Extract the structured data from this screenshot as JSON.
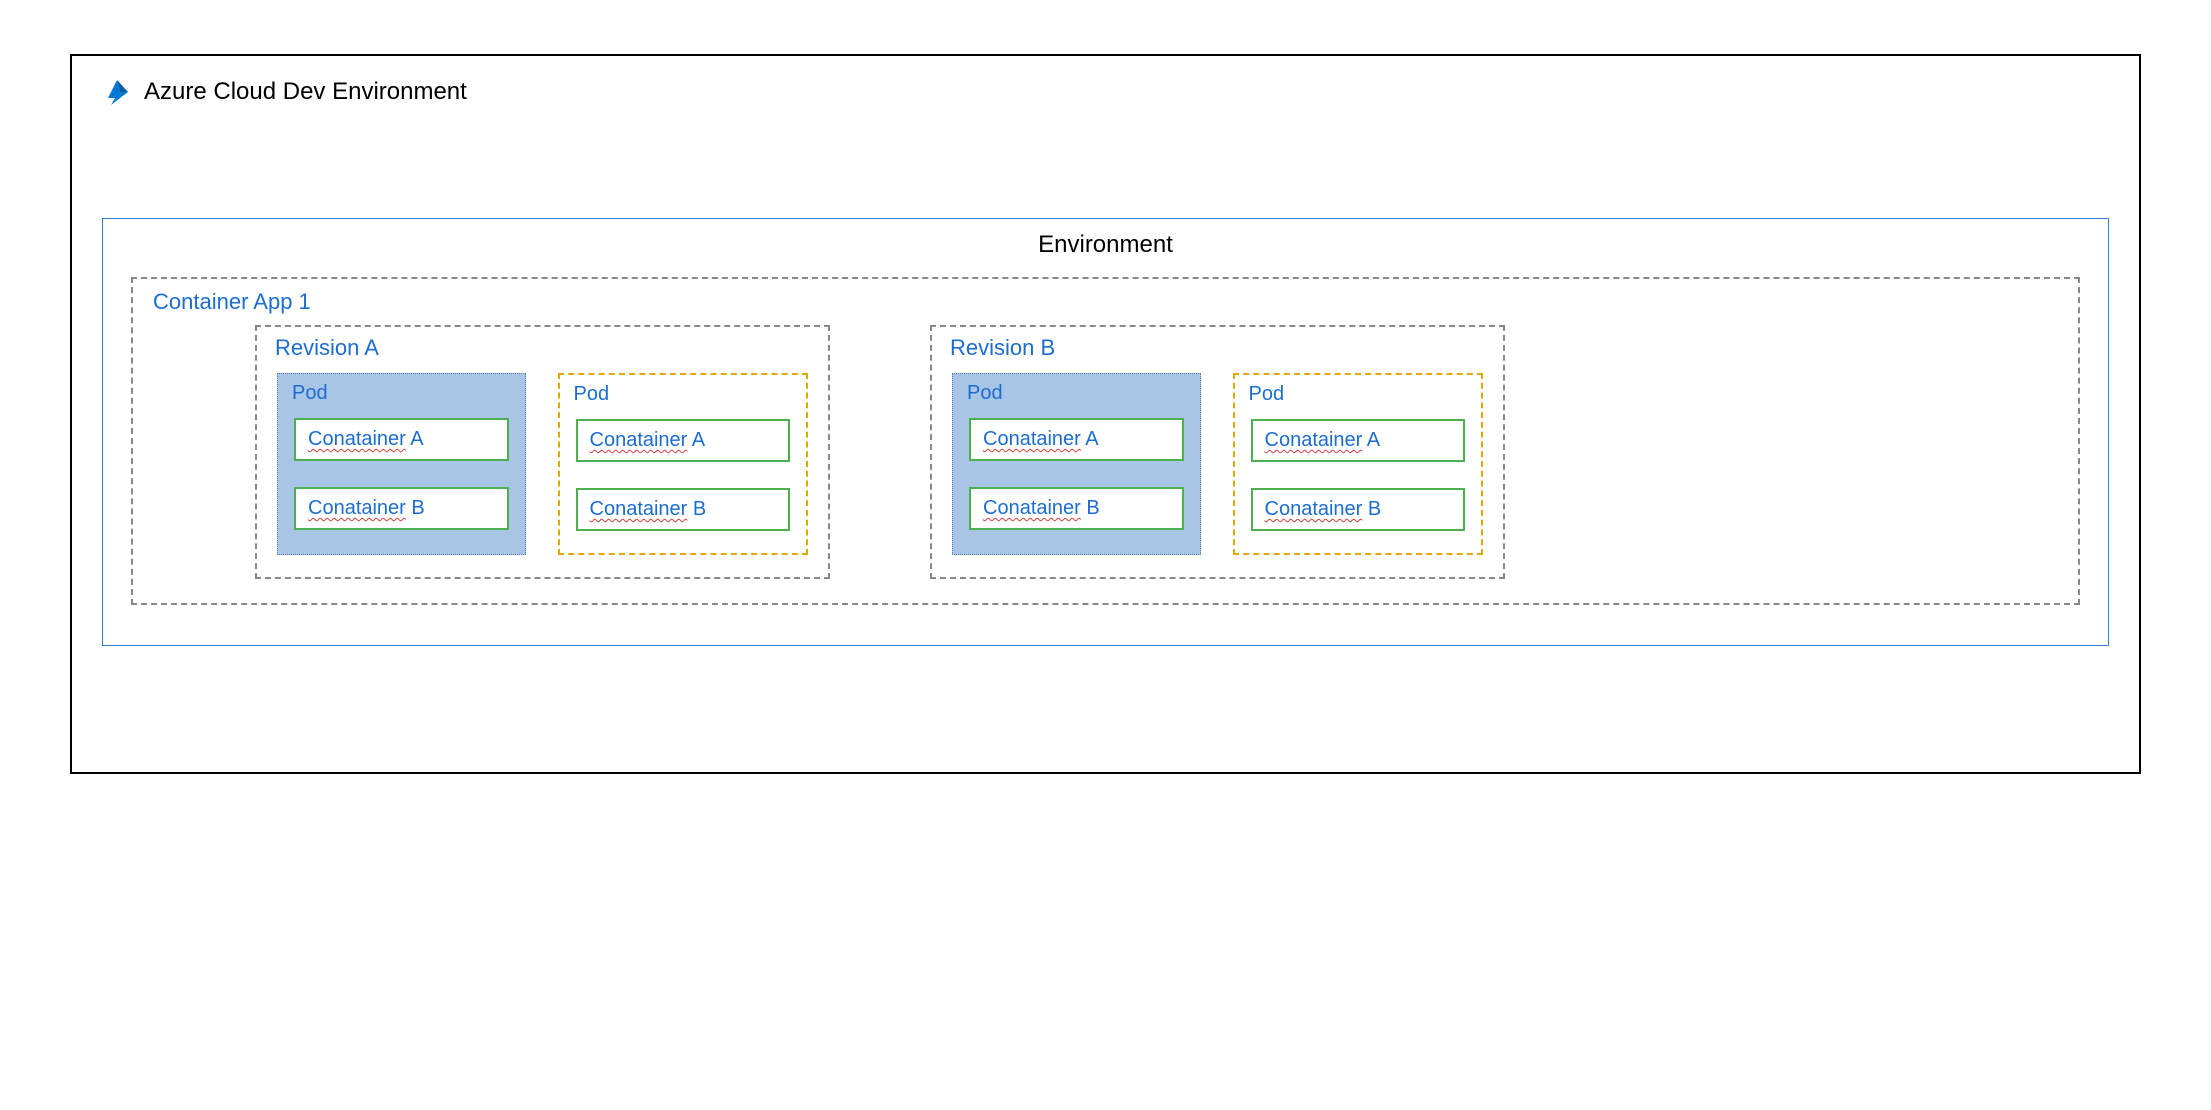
{
  "title": "Azure Cloud Dev Environment",
  "environment": {
    "label": "Environment",
    "apps": [
      {
        "label": "Container App 1",
        "revisions": [
          {
            "label": "Revision A",
            "pods": [
              {
                "label": "Pod",
                "style": "blue",
                "containers": [
                  {
                    "word": "Conatainer",
                    "suffix": " A"
                  },
                  {
                    "word": "Conatainer",
                    "suffix": " B"
                  }
                ]
              },
              {
                "label": "Pod",
                "style": "yellow",
                "containers": [
                  {
                    "word": "Conatainer",
                    "suffix": " A"
                  },
                  {
                    "word": "Conatainer",
                    "suffix": " B"
                  }
                ]
              }
            ]
          },
          {
            "label": "Revision B",
            "pods": [
              {
                "label": "Pod",
                "style": "blue",
                "containers": [
                  {
                    "word": "Conatainer",
                    "suffix": " A"
                  },
                  {
                    "word": "Conatainer",
                    "suffix": " B"
                  }
                ]
              },
              {
                "label": "Pod",
                "style": "yellow",
                "containers": [
                  {
                    "word": "Conatainer",
                    "suffix": " A"
                  },
                  {
                    "word": "Conatainer",
                    "suffix": " B"
                  }
                ]
              }
            ]
          }
        ]
      }
    ]
  },
  "colors": {
    "azure_icon": "#0078d4",
    "link_blue": "#1c6dd0",
    "pod_blue_fill": "#a8c5e6",
    "pod_yellow_border": "#e0a800",
    "container_green": "#4caf50",
    "dash_gray": "#888888"
  }
}
